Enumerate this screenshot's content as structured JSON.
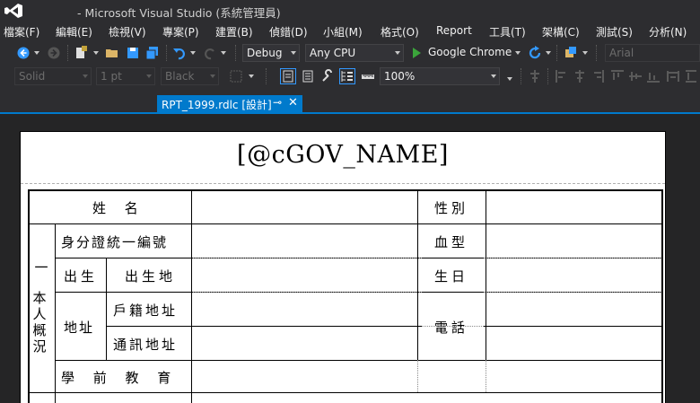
{
  "titlebar": {
    "title": "- Microsoft Visual Studio (系統管理員)"
  },
  "menu": {
    "items": [
      "檔案(F)",
      "編輯(E)",
      "檢視(V)",
      "專案(P)",
      "建置(B)",
      "偵錯(D)",
      "小組(M)",
      "格式(O)",
      "Report",
      "工具(T)",
      "架構(C)",
      "測試(S)",
      "分析(N)"
    ]
  },
  "toolbar1": {
    "config": "Debug",
    "platform": "Any CPU",
    "run_target": "Google Chrome",
    "font_name": "Arial"
  },
  "toolbar2": {
    "border_style": "Solid",
    "border_width": "1 pt",
    "border_color": "Black",
    "zoom": "100%"
  },
  "tab": {
    "label": "RPT_1999.rdlc [設計]",
    "pin": "⊸",
    "close": "✕"
  },
  "report": {
    "title": "[@cGOV_NAME]",
    "labels": {
      "name": "姓  名",
      "gender": "性別",
      "id_number": "身分證統一編號",
      "blood_type": "血型",
      "birth": "出生",
      "birthplace": "出生地",
      "birthday": "生日",
      "address": "地址",
      "registered_address": "戶籍地址",
      "phone": "電話",
      "mailing_address": "通訊地址",
      "preschool": "學  前  教  育",
      "section_num": "一",
      "section_title": "本人概況"
    }
  },
  "colors": {
    "accent": "#007acc",
    "background": "#2d2d30",
    "play_green": "#3ba53b"
  }
}
